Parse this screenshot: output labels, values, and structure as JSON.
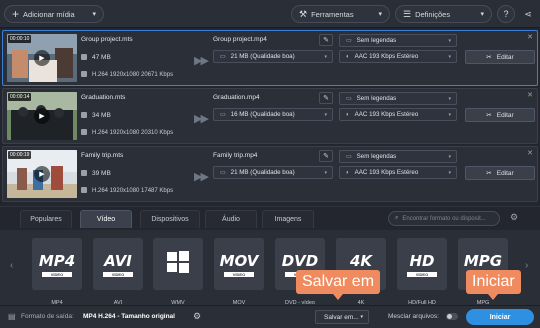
{
  "toolbar": {
    "add_media": "Adicionar mídia",
    "tools": "Ferramentas",
    "settings": "Definições",
    "help": "?"
  },
  "files": [
    {
      "duration": "00:00:10",
      "name": "Group project.mts",
      "size": "47 MB",
      "codec": "H.264 1920x1080 20671 Kbps",
      "out_name": "Group project.mp4",
      "out_size": "21 MB (Qualidade boa)",
      "subs": "Sem legendas",
      "audio": "AAC 193 Kbps Estéreo",
      "edit": "Editar"
    },
    {
      "duration": "00:00:14",
      "name": "Graduation.mts",
      "size": "34 MB",
      "codec": "H.264 1920x1080 20310 Kbps",
      "out_name": "Graduation.mp4",
      "out_size": "16 MB (Qualidade boa)",
      "subs": "Sem legendas",
      "audio": "AAC 193 Kbps Estéreo",
      "edit": "Editar"
    },
    {
      "duration": "00:00:19",
      "name": "Family trip.mts",
      "size": "39 MB",
      "codec": "H.264 1920x1080 17487 Kbps",
      "out_name": "Family trip.mp4",
      "out_size": "21 MB (Qualidade boa)",
      "subs": "Sem legendas",
      "audio": "AAC 193 Kbps Estéreo",
      "edit": "Editar"
    }
  ],
  "tabs": [
    "Populares",
    "Vídeo",
    "Dispositivos",
    "Áudio",
    "Imagens"
  ],
  "search_placeholder": "Encontrar formato ou disposit...",
  "formats": [
    {
      "logo": "MP4",
      "sub": "VIDEO",
      "label": "MP4"
    },
    {
      "logo": "AVI",
      "sub": "VIDEO",
      "label": "AVI"
    },
    {
      "logo": "",
      "sub": "",
      "label": "WMV"
    },
    {
      "logo": "MOV",
      "sub": "VIDEO",
      "label": "MOV"
    },
    {
      "logo": "DVD",
      "sub": "VIDEO",
      "label": "DVD - vídeo compatível"
    },
    {
      "logo": "4K",
      "sub": "ULTRA HD",
      "label": "4K"
    },
    {
      "logo": "HD",
      "sub": "VIDEO",
      "label": "HD/Full HD"
    },
    {
      "logo": "MPG",
      "sub": "VIDEO",
      "label": "MPG"
    }
  ],
  "bottom": {
    "output_label": "Formato de saída:",
    "output_value": "MP4 H.264 - Tamanho original",
    "save_to": "Salvar em...",
    "merge": "Mesclar arquivos:",
    "start": "Iniciar"
  },
  "tooltips": {
    "save": "Salvar em",
    "start": "Iniciar"
  },
  "colors": {
    "accent": "#3d7fd6",
    "start": "#2f8fe0",
    "tip": "#f08b5f"
  }
}
